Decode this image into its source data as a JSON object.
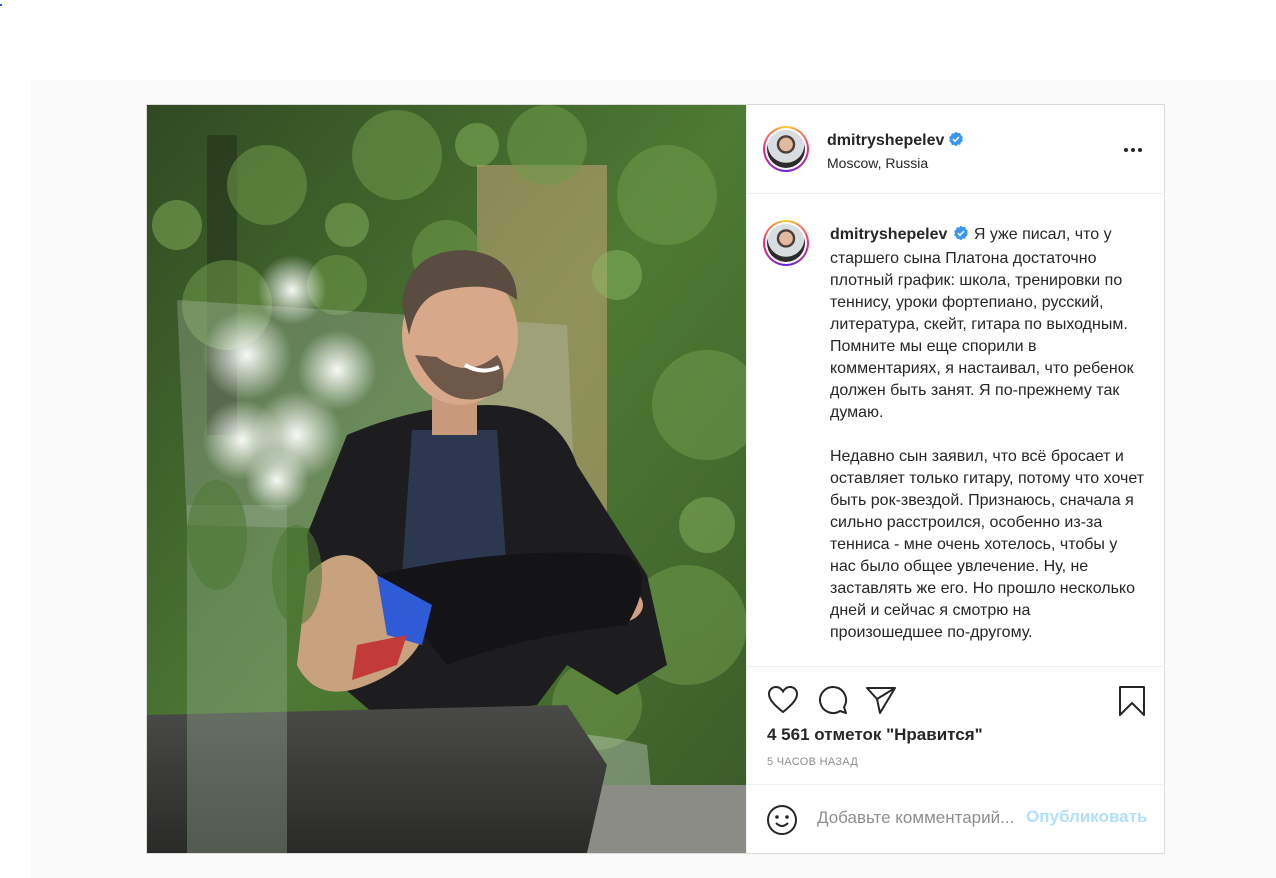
{
  "post": {
    "username": "dmitryshepelev",
    "location": "Moscow, Russia",
    "caption": "Я уже писал, что у старшего сына Платона достаточно плотный график: школа, тренировки по теннису, уроки фортепиано, русский, литература, скейт, гитара по выходным. Помните мы еще спорили в комментариях, я настаивал, что ребенок должен быть занят. Я по-прежнему так думаю.\n\nНедавно сын заявил, что всё бросает и оставляет только гитару, потому что хочет быть рок-звездой. Признаюсь, сначала я сильно расстроился, особенно из-за тенниса - мне очень хотелось, чтобы у нас было общее увлечение. Ну, не заставлять же его. Но прошло несколько дней и сейчас я смотрю на произошедшее по-другому.",
    "likes": "4 561 отметок \"Нравится\"",
    "time_ago": "5 ЧАСОВ НАЗАД"
  },
  "comment": {
    "placeholder": "Добавьте комментарий...",
    "publish_label": "Опубликовать"
  },
  "icons": {
    "verified": "verified-badge-icon",
    "more": "more-options-icon",
    "like": "heart-icon",
    "comment": "comment-bubble-icon",
    "share": "paper-plane-icon",
    "save": "bookmark-icon",
    "emoji": "smiley-icon"
  },
  "colors": {
    "verified": "#3897f0",
    "publish_disabled": "#b2dffc",
    "muted_text": "#8e8e8e",
    "border": "#dbdbdb"
  }
}
